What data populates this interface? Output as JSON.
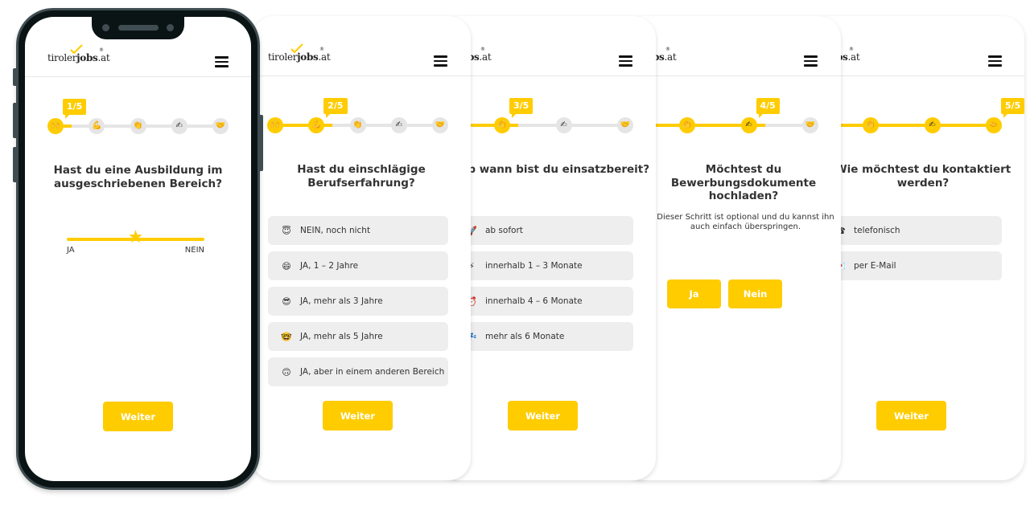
{
  "brand": {
    "logo_prefix": "tiroler",
    "logo_bold": "jobs",
    "logo_suffix": ".at",
    "logo_mark": "®",
    "accent_color": "#ffcc00",
    "track_color": "#e5e5e5",
    "option_bg": "#eeeeee"
  },
  "step_icons": [
    {
      "name": "raised-hands-icon",
      "glyph": "🙌"
    },
    {
      "name": "flexed-biceps-icon",
      "glyph": "💪"
    },
    {
      "name": "clapping-hands-icon",
      "glyph": "👏"
    },
    {
      "name": "writing-hand-icon",
      "glyph": "✍"
    },
    {
      "name": "handshake-icon",
      "glyph": "🤝"
    }
  ],
  "screens": [
    {
      "step_label": "1/5",
      "current_step": 1,
      "total_steps": 5,
      "question": "Hast du eine Ausbildung im ausgeschriebenen Bereich?",
      "slider": {
        "min_label": "JA",
        "max_label": "NEIN",
        "value": 0.5,
        "handle_glyph": "★"
      },
      "button": "Weiter"
    },
    {
      "step_label": "2/5",
      "current_step": 2,
      "total_steps": 5,
      "question": "Hast du einschlägige Berufserfahrung?",
      "options": [
        {
          "icon": "smiling-face-with-halo-icon",
          "glyph": "😇",
          "label": "NEIN, noch nicht"
        },
        {
          "icon": "grinning-face-icon",
          "glyph": "😄",
          "label": "JA, 1 – 2 Jahre"
        },
        {
          "icon": "sunglasses-face-icon",
          "glyph": "😎",
          "label": "JA, mehr als 3 Jahre"
        },
        {
          "icon": "nerd-face-icon",
          "glyph": "🤓",
          "label": "JA, mehr als 5 Jahre"
        },
        {
          "icon": "upside-down-face-icon",
          "glyph": "🙃",
          "label": "JA, aber in einem anderen Bereich"
        }
      ],
      "button": "Weiter"
    },
    {
      "step_label": "3/5",
      "current_step": 3,
      "total_steps": 5,
      "question": "Ab wann bist du einsatzbereit?",
      "options": [
        {
          "icon": "rocket-icon",
          "glyph": "🚀",
          "label": "ab sofort"
        },
        {
          "icon": "lightning-icon",
          "glyph": "⚡",
          "label": "innerhalb 1 – 3 Monate"
        },
        {
          "icon": "alarm-clock-icon",
          "glyph": "⏰",
          "label": "innerhalb 4 – 6 Monate"
        },
        {
          "icon": "zzz-icon",
          "glyph": "💤",
          "label": "mehr als 6 Monate"
        }
      ],
      "button": "Weiter"
    },
    {
      "step_label": "4/5",
      "current_step": 4,
      "total_steps": 5,
      "question": "Möchtest du Bewerbungsdokumente hochladen?",
      "subtext": "Dieser Schritt ist optional und du kannst ihn auch einfach überspringen.",
      "yes_label": "Ja",
      "no_label": "Nein"
    },
    {
      "step_label": "5/5",
      "current_step": 5,
      "total_steps": 5,
      "question": "Wie möchtest du kontaktiert werden?",
      "options": [
        {
          "icon": "telephone-icon",
          "glyph": "☎",
          "label": "telefonisch"
        },
        {
          "icon": "love-letter-icon",
          "glyph": "💌",
          "label": "per E-Mail"
        }
      ],
      "button": "Weiter"
    }
  ]
}
